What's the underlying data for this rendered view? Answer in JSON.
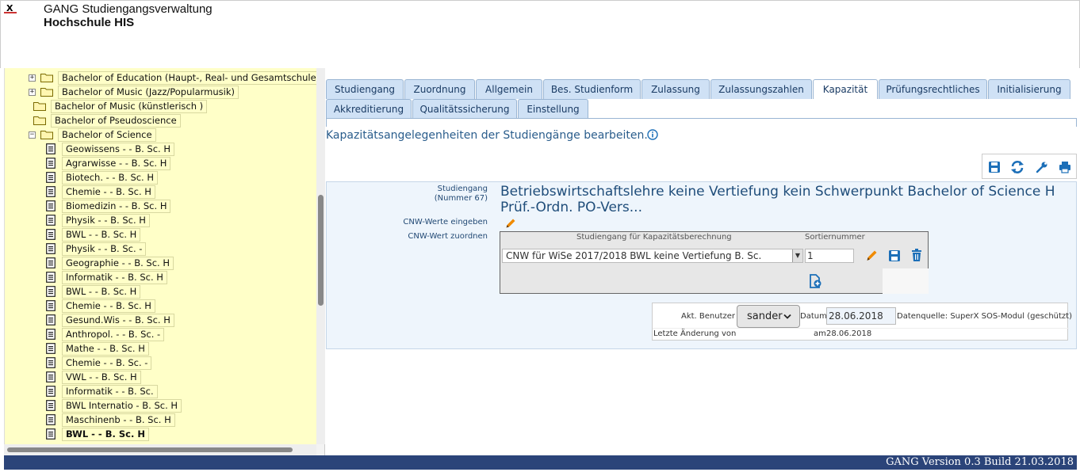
{
  "header": {
    "app_title": "GANG Studiengangsverwaltung",
    "org_title": "Hochschule HIS",
    "logo_text": "X"
  },
  "tree": {
    "items": [
      {
        "label": "Bachelor of Education (Haupt-, Real- und Gesamtschule)",
        "type": "folder",
        "toggle": "+"
      },
      {
        "label": "Bachelor of Music (Jazz/Popularmusik)",
        "type": "folder",
        "toggle": "+"
      },
      {
        "label": "Bachelor of Music (künstlerisch )",
        "type": "folder",
        "toggle": ""
      },
      {
        "label": "Bachelor of Pseudoscience",
        "type": "folder",
        "toggle": ""
      },
      {
        "label": "Bachelor of Science",
        "type": "folder-open",
        "toggle": "−"
      },
      {
        "label": "Geowissens - - B. Sc. H",
        "type": "doc"
      },
      {
        "label": "Agrarwisse - - B. Sc. H",
        "type": "doc"
      },
      {
        "label": "Biotech. - - B. Sc. H",
        "type": "doc"
      },
      {
        "label": "Chemie - - B. Sc. H",
        "type": "doc"
      },
      {
        "label": "Biomedizin - - B. Sc. H",
        "type": "doc"
      },
      {
        "label": "Physik - - B. Sc. H",
        "type": "doc"
      },
      {
        "label": "BWL - - B. Sc. H",
        "type": "doc"
      },
      {
        "label": "Physik - - B. Sc. -",
        "type": "doc"
      },
      {
        "label": "Geographie - - B. Sc. H",
        "type": "doc"
      },
      {
        "label": "Informatik - - B. Sc. H",
        "type": "doc"
      },
      {
        "label": "BWL - - B. Sc. H",
        "type": "doc"
      },
      {
        "label": "Chemie - - B. Sc. H",
        "type": "doc"
      },
      {
        "label": "Gesund.Wis - - B. Sc. H",
        "type": "doc"
      },
      {
        "label": "Anthropol. - - B. Sc. -",
        "type": "doc"
      },
      {
        "label": "Mathe - - B. Sc. H",
        "type": "doc"
      },
      {
        "label": "Chemie - - B. Sc. -",
        "type": "doc"
      },
      {
        "label": "VWL - - B. Sc. H",
        "type": "doc"
      },
      {
        "label": "Informatik - - B. Sc.",
        "type": "doc"
      },
      {
        "label": "BWL Internatio - B. Sc. H",
        "type": "doc"
      },
      {
        "label": "Maschinenb - - B. Sc. H",
        "type": "doc"
      },
      {
        "label": "BWL - - B. Sc. H",
        "type": "doc",
        "selected": true
      }
    ]
  },
  "tabs": {
    "row1": [
      "Studiengang",
      "Zuordnung",
      "Allgemein",
      "Bes. Studienform",
      "Zulassung",
      "Zulassungszahlen",
      "Kapazität",
      "Prüfungsrechtliches",
      "Initialisierung"
    ],
    "row2": [
      "Akkreditierung",
      "Qualitätssicherung",
      "Einstellung"
    ],
    "active": "Kapazität"
  },
  "main": {
    "description": "Kapazitätsangelegenheiten der Studiengänge bearbeiten.",
    "labels": {
      "studiengang": "Studiengang",
      "nummer": "(Nummer 67)",
      "cnw_eingeben": "CNW-Werte eingeben",
      "cnw_zuordnen": "CNW-Wert zuordnen"
    },
    "studiengang_value": "Betriebswirtschaftslehre keine Vertiefung kein Schwerpunkt Bachelor of Science H Prüf.-Ordn. PO-Vers...",
    "cnw_table": {
      "col_studiengang": "Studiengang für Kapazitätsberechnung",
      "col_sortiernummer": "Sortiernummer",
      "selected_value": "CNW für WiSe 2017/2018 BWL keine Vertiefung B. Sc.",
      "sort_value": "1"
    },
    "user_box": {
      "akt_benutzer_label": "Akt. Benutzer",
      "user": "sander",
      "datum_label": "Datum",
      "datum_value": "28.06.2018",
      "source": "Datenquelle: SuperX SOS-Modul (geschützt)",
      "letzte_aenderung_label": "Letzte Änderung von",
      "am_label": "am",
      "am_date": "28.06.2018"
    }
  },
  "footer": {
    "version": "GANG Version 0.3 Build 21.03.2018"
  },
  "colors": {
    "accent": "#2a5d8c",
    "footer_bg": "#2b4479",
    "tree_bg": "#ffffc8",
    "tab_bg": "#cfe1f5",
    "pencil": "#f08a00",
    "icon_blue": "#1c6fb8"
  }
}
